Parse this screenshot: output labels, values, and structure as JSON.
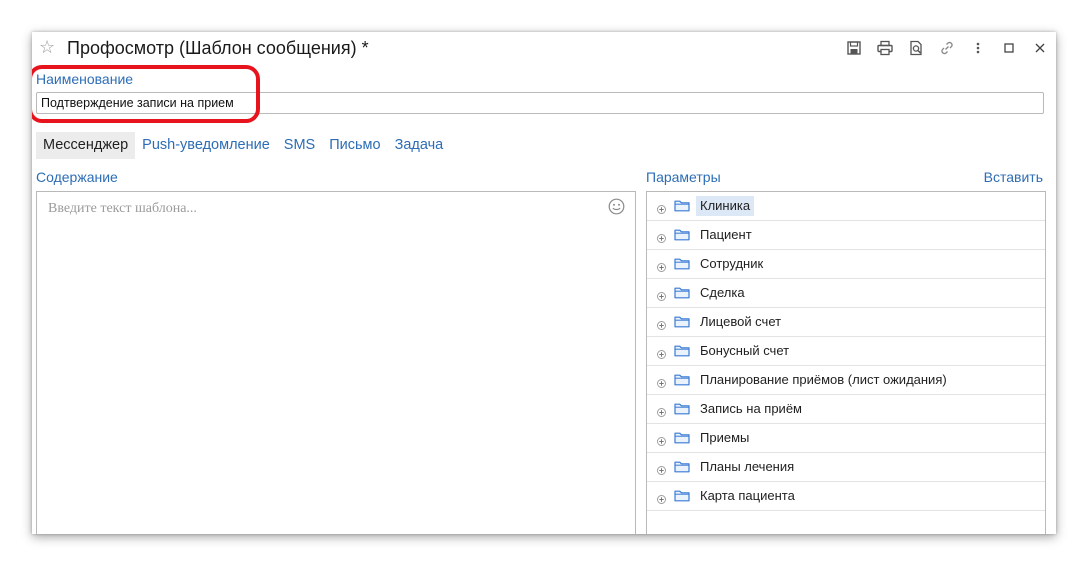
{
  "window": {
    "title": "Профосмотр (Шаблон сообщения) *"
  },
  "name_field": {
    "label": "Наименование",
    "value": "Подтверждение записи на прием"
  },
  "tabs": [
    {
      "label": "Мессенджер",
      "active": true
    },
    {
      "label": "Push-уведомление",
      "active": false
    },
    {
      "label": "SMS",
      "active": false
    },
    {
      "label": "Письмо",
      "active": false
    },
    {
      "label": "Задача",
      "active": false
    }
  ],
  "content": {
    "label": "Содержание",
    "placeholder": "Введите текст шаблона..."
  },
  "parameters": {
    "label": "Параметры",
    "insert_label": "Вставить",
    "items": [
      {
        "label": "Клиника",
        "selected": true
      },
      {
        "label": "Пациент"
      },
      {
        "label": "Сотрудник"
      },
      {
        "label": "Сделка"
      },
      {
        "label": "Лицевой счет"
      },
      {
        "label": "Бонусный счет"
      },
      {
        "label": "Планирование приёмов (лист ожидания)"
      },
      {
        "label": "Запись на приём"
      },
      {
        "label": "Приемы"
      },
      {
        "label": "Планы лечения"
      },
      {
        "label": "Карта пациента"
      }
    ]
  },
  "colors": {
    "accent_blue": "#2d6db5",
    "highlight_red": "#e8141d",
    "folder_blue": "#3a7bd5"
  }
}
